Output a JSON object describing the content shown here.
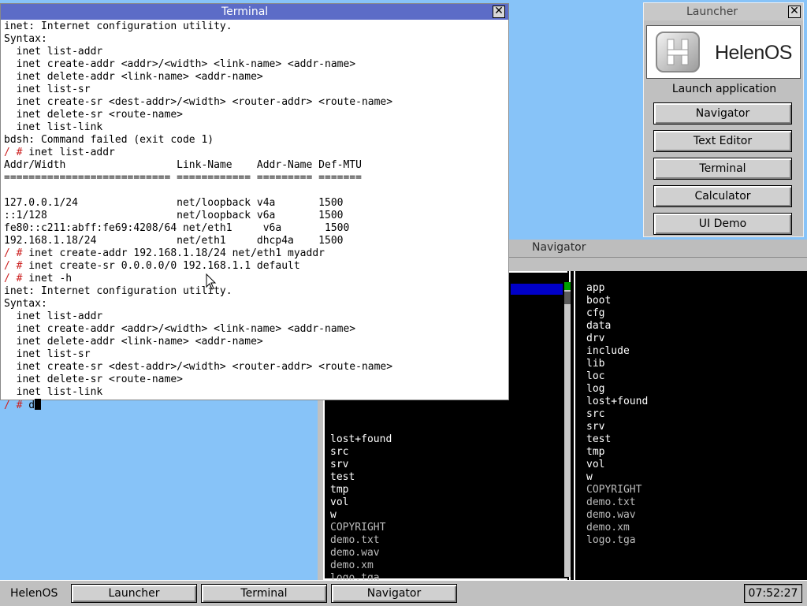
{
  "terminal": {
    "title": "Terminal",
    "close_glyph": "✕",
    "lines": [
      {
        "prompt": "",
        "text": "inet: Internet configuration utility."
      },
      {
        "prompt": "",
        "text": "Syntax:"
      },
      {
        "prompt": "",
        "text": "  inet list-addr"
      },
      {
        "prompt": "",
        "text": "  inet create-addr <addr>/<width> <link-name> <addr-name>"
      },
      {
        "prompt": "",
        "text": "  inet delete-addr <link-name> <addr-name>"
      },
      {
        "prompt": "",
        "text": "  inet list-sr"
      },
      {
        "prompt": "",
        "text": "  inet create-sr <dest-addr>/<width> <router-addr> <route-name>"
      },
      {
        "prompt": "",
        "text": "  inet delete-sr <route-name>"
      },
      {
        "prompt": "",
        "text": "  inet list-link"
      },
      {
        "prompt": "",
        "text": "bdsh: Command failed (exit code 1)"
      },
      {
        "prompt": "/ #",
        "text": " inet list-addr"
      },
      {
        "prompt": "",
        "text": "Addr/Width                  Link-Name    Addr-Name Def-MTU"
      },
      {
        "prompt": "",
        "text": "=========================== ============ ========= ======="
      },
      {
        "prompt": "",
        "text": ""
      },
      {
        "prompt": "",
        "text": "127.0.0.1/24                net/loopback v4a       1500"
      },
      {
        "prompt": "",
        "text": "::1/128                     net/loopback v6a       1500"
      },
      {
        "prompt": "",
        "text": "fe80::c211:abff:fe69:4208/64 net/eth1     v6a       1500"
      },
      {
        "prompt": "",
        "text": "192.168.1.18/24             net/eth1     dhcp4a    1500"
      },
      {
        "prompt": "/ #",
        "text": " inet create-addr 192.168.1.18/24 net/eth1 myaddr"
      },
      {
        "prompt": "/ #",
        "text": " inet create-sr 0.0.0.0/0 192.168.1.1 default"
      },
      {
        "prompt": "/ #",
        "text": " inet -h"
      },
      {
        "prompt": "",
        "text": "inet: Internet configuration utility."
      },
      {
        "prompt": "",
        "text": "Syntax:"
      },
      {
        "prompt": "",
        "text": "  inet list-addr"
      },
      {
        "prompt": "",
        "text": "  inet create-addr <addr>/<width> <link-name> <addr-name>"
      },
      {
        "prompt": "",
        "text": "  inet delete-addr <link-name> <addr-name>"
      },
      {
        "prompt": "",
        "text": "  inet list-sr"
      },
      {
        "prompt": "",
        "text": "  inet create-sr <dest-addr>/<width> <router-addr> <route-name>"
      },
      {
        "prompt": "",
        "text": "  inet delete-sr <route-name>"
      },
      {
        "prompt": "",
        "text": "  inet list-link"
      }
    ],
    "input_prompt": "/ #",
    "input_text": " d"
  },
  "launcher": {
    "title": "Launcher",
    "logo_text": "HelenOS",
    "heading": "Launch application",
    "buttons": [
      "Navigator",
      "Text Editor",
      "Terminal",
      "Calculator",
      "UI Demo"
    ]
  },
  "navigator": {
    "title": "Navigator",
    "left_panel": [
      {
        "name": "lost+found",
        "kind": "dir"
      },
      {
        "name": "src",
        "kind": "dir"
      },
      {
        "name": "srv",
        "kind": "dir"
      },
      {
        "name": "test",
        "kind": "dir"
      },
      {
        "name": "tmp",
        "kind": "dir"
      },
      {
        "name": "vol",
        "kind": "dir"
      },
      {
        "name": "w",
        "kind": "dir"
      },
      {
        "name": "COPYRIGHT",
        "kind": "file"
      },
      {
        "name": "demo.txt",
        "kind": "file"
      },
      {
        "name": "demo.wav",
        "kind": "file"
      },
      {
        "name": "demo.xm",
        "kind": "file"
      },
      {
        "name": "logo.tga",
        "kind": "file"
      }
    ],
    "right_panel": [
      {
        "name": "app",
        "kind": "dir"
      },
      {
        "name": "boot",
        "kind": "dir"
      },
      {
        "name": "cfg",
        "kind": "dir"
      },
      {
        "name": "data",
        "kind": "dir"
      },
      {
        "name": "drv",
        "kind": "dir"
      },
      {
        "name": "include",
        "kind": "dir"
      },
      {
        "name": "lib",
        "kind": "dir"
      },
      {
        "name": "loc",
        "kind": "dir"
      },
      {
        "name": "log",
        "kind": "dir"
      },
      {
        "name": "lost+found",
        "kind": "dir"
      },
      {
        "name": "src",
        "kind": "dir"
      },
      {
        "name": "srv",
        "kind": "dir"
      },
      {
        "name": "test",
        "kind": "dir"
      },
      {
        "name": "tmp",
        "kind": "dir"
      },
      {
        "name": "vol",
        "kind": "dir"
      },
      {
        "name": "w",
        "kind": "dir"
      },
      {
        "name": "COPYRIGHT",
        "kind": "file"
      },
      {
        "name": "demo.txt",
        "kind": "file"
      },
      {
        "name": "demo.wav",
        "kind": "file"
      },
      {
        "name": "demo.xm",
        "kind": "file"
      },
      {
        "name": "logo.tga",
        "kind": "file"
      }
    ]
  },
  "taskbar": {
    "start_label": "HelenOS",
    "windows": [
      "Launcher",
      "Terminal",
      "Navigator"
    ],
    "clock": "07:52:27"
  },
  "colors": {
    "desktop": "#87c3f8",
    "terminal_title_bar": "#5c6cc7",
    "prompt": "#cc2222",
    "nav_selection": "#0000c8"
  }
}
